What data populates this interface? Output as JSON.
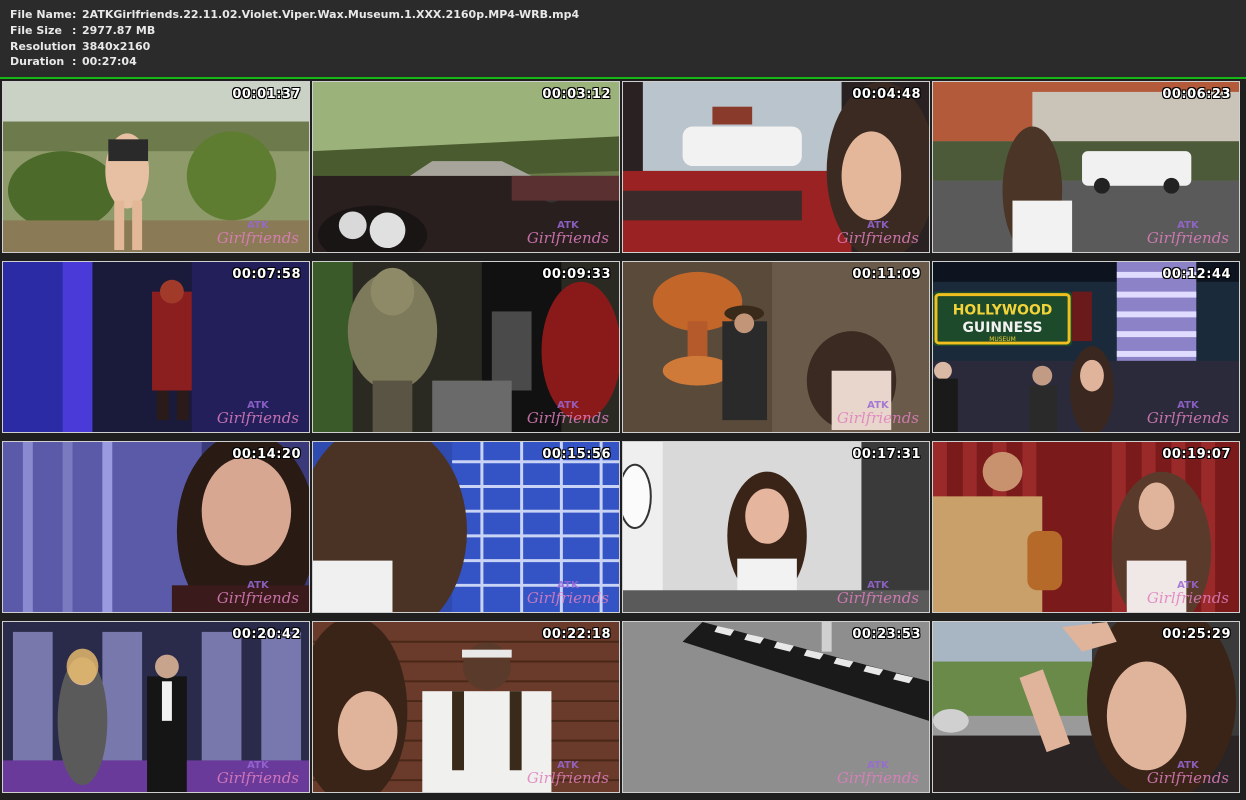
{
  "file_info": {
    "name_label": "File Name",
    "name_value": "2ATKGirlfriends.22.11.02.Violet.Viper.Wax.Museum.1.XXX.2160p.MP4-WRB.mp4",
    "size_label": "File Size",
    "size_value": "2977.87 MB",
    "resolution_label": "Resolution",
    "resolution_value": "3840x2160",
    "duration_label": "Duration",
    "duration_value": "00:27:04",
    "separator": ":"
  },
  "colors": {
    "background": "#2b2b2b",
    "grid_rule": "#15b615",
    "timestamp": "#ffffff",
    "watermark_top": "#9a68d6",
    "watermark_main": "#e07fbf"
  },
  "watermark": {
    "top": "ATK",
    "main": "Girlfriends"
  },
  "thumbnails": [
    {
      "time": "00:01:37",
      "scene": "garden-hedges"
    },
    {
      "time": "00:03:12",
      "scene": "car-dashboard-tree-road"
    },
    {
      "time": "00:04:48",
      "scene": "car-interior-closeup"
    },
    {
      "time": "00:06:23",
      "scene": "street-sidewalk"
    },
    {
      "time": "00:07:58",
      "scene": "blue-purple-wax-figure"
    },
    {
      "time": "00:09:33",
      "scene": "goblin-creature-display"
    },
    {
      "time": "00:11:09",
      "scene": "mushroom-cloud-cowboy"
    },
    {
      "time": "00:12:44",
      "scene": "hollywood-guinness-museum-sign"
    },
    {
      "time": "00:14:20",
      "scene": "blue-curtain-closeup"
    },
    {
      "time": "00:15:56",
      "scene": "blue-brick-wall-hair"
    },
    {
      "time": "00:17:31",
      "scene": "white-room-woman"
    },
    {
      "time": "00:19:07",
      "scene": "red-curtain-guitar-figure"
    },
    {
      "time": "00:20:42",
      "scene": "mirror-room-figures"
    },
    {
      "time": "00:22:18",
      "scene": "brick-wall-wax-figure"
    },
    {
      "time": "00:23:53",
      "scene": "gray-floor-stripes"
    },
    {
      "time": "00:25:29",
      "scene": "car-window-selfie"
    }
  ],
  "hollywood_sign": {
    "line1": "HOLLYWOOD",
    "line2": "GUINNESS",
    "line3": "MUSEUM"
  }
}
